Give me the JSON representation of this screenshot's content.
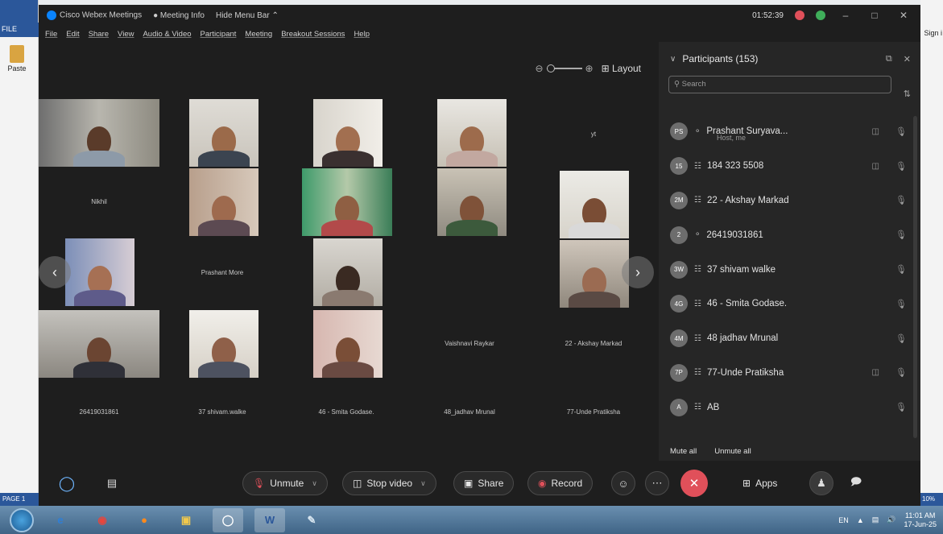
{
  "word": {
    "file_tab": "FILE",
    "paste_label": "Paste",
    "signin": "Sign i",
    "page_status": "PAGE 1",
    "zoom_pct": "10%"
  },
  "titlebar": {
    "app": "Cisco Webex Meetings",
    "meeting_info": "Meeting Info",
    "hide_menu": "Hide Menu Bar",
    "timer": "01:52:39"
  },
  "menu": [
    "File",
    "Edit",
    "Share",
    "View",
    "Audio & Video",
    "Participant",
    "Meeting",
    "Breakout Sessions",
    "Help"
  ],
  "stage": {
    "layout_label": "Layout",
    "tile_names": {
      "nikhil": "Nikhil",
      "prashant_more": "Prashant More",
      "vaishnavi": "Vaishnavi Raykar",
      "akshay": "22 - Akshay Markad",
      "num": "26419031861",
      "shivam": "37 shivam.walke",
      "smita": "46 - Smita Godase.",
      "jadhav": "48_jadhav Mrunal",
      "unde": "77-Unde Pratiksha",
      "yt": "yt"
    }
  },
  "panel": {
    "title": "Participants (153)",
    "search_placeholder": "Search",
    "participants": [
      {
        "initials": "PS",
        "name": "Prashant Suryava...",
        "sub": "Host, me",
        "video": true
      },
      {
        "initials": "15",
        "name": "184 323 5508",
        "sub": "",
        "video": true
      },
      {
        "initials": "2M",
        "name": "22 - Akshay Markad",
        "sub": "",
        "video": false
      },
      {
        "initials": "2",
        "name": "26419031861",
        "sub": "",
        "video": false
      },
      {
        "initials": "3W",
        "name": "37 shivam walke",
        "sub": "",
        "video": false
      },
      {
        "initials": "4G",
        "name": "46 - Smita Godase.",
        "sub": "",
        "video": false
      },
      {
        "initials": "4M",
        "name": "48 jadhav Mrunal",
        "sub": "",
        "video": false
      },
      {
        "initials": "7P",
        "name": "77-Unde Pratiksha",
        "sub": "",
        "video": true
      },
      {
        "initials": "A",
        "name": "AB",
        "sub": "",
        "video": false
      }
    ],
    "mute_all": "Mute all",
    "unmute_all": "Unmute all"
  },
  "toolbar": {
    "unmute": "Unmute",
    "stop_video": "Stop video",
    "share": "Share",
    "record": "Record",
    "apps": "Apps"
  },
  "taskbar": {
    "lang": "EN",
    "time": "11:01 AM",
    "date": "17-Jun-25"
  }
}
